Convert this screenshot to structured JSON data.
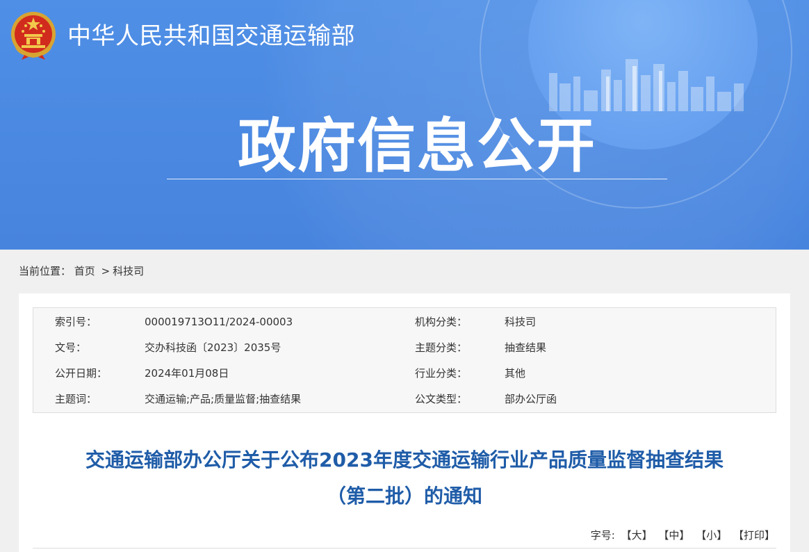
{
  "header": {
    "site_title": "中华人民共和国交通运输部",
    "section_title": "政府信息公开",
    "emblem_icon": "national-emblem-icon",
    "banner_color": "#4a88e1"
  },
  "breadcrumb": {
    "label": "当前位置：",
    "items": [
      "首页",
      "科技司"
    ],
    "separator": ">"
  },
  "metadata": {
    "rows": [
      {
        "k1": "索引号：",
        "v1": "000019713O11/2024-00003",
        "k2": "机构分类：",
        "v2": "科技司"
      },
      {
        "k1": "文号：",
        "v1": "交办科技函〔2023〕2035号",
        "k2": "主题分类：",
        "v2": "抽查结果"
      },
      {
        "k1": "公开日期：",
        "v1": "2024年01月08日",
        "k2": "行业分类：",
        "v2": "其他"
      },
      {
        "k1": "主题词：",
        "v1": "交通运输;产品;质量监督;抽查结果",
        "k2": "公文类型：",
        "v2": "部办公厅函"
      }
    ]
  },
  "document": {
    "title_line1": "交通运输部办公厅关于公布2023年度交通运输行业产品质量监督抽查结果",
    "title_line2": "（第二批）的通知",
    "title_color": "#1f5ca8"
  },
  "font_tools": {
    "label": "字号:",
    "large": "【大】",
    "medium": "【中】",
    "small": "【小】",
    "print": "【打印】"
  }
}
